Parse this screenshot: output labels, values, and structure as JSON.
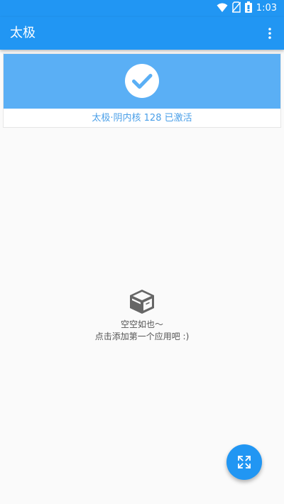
{
  "status_bar": {
    "time": "1:03",
    "icons": [
      "wifi-icon",
      "no-sim-icon",
      "battery-icon"
    ]
  },
  "app_bar": {
    "title": "太极",
    "menu_icon": "more-vert-icon"
  },
  "status_card": {
    "icon": "check-icon",
    "text": "太极·阴内核 128 已激活",
    "banner_color": "#5aaff5",
    "text_color": "#4a9fe8"
  },
  "empty_state": {
    "icon": "box-icon",
    "line1": "空空如也～",
    "line2": "点击添加第一个应用吧 :)"
  },
  "fab": {
    "icon": "expand-icon"
  },
  "colors": {
    "primary": "#2196f3",
    "background": "#fafafa"
  }
}
